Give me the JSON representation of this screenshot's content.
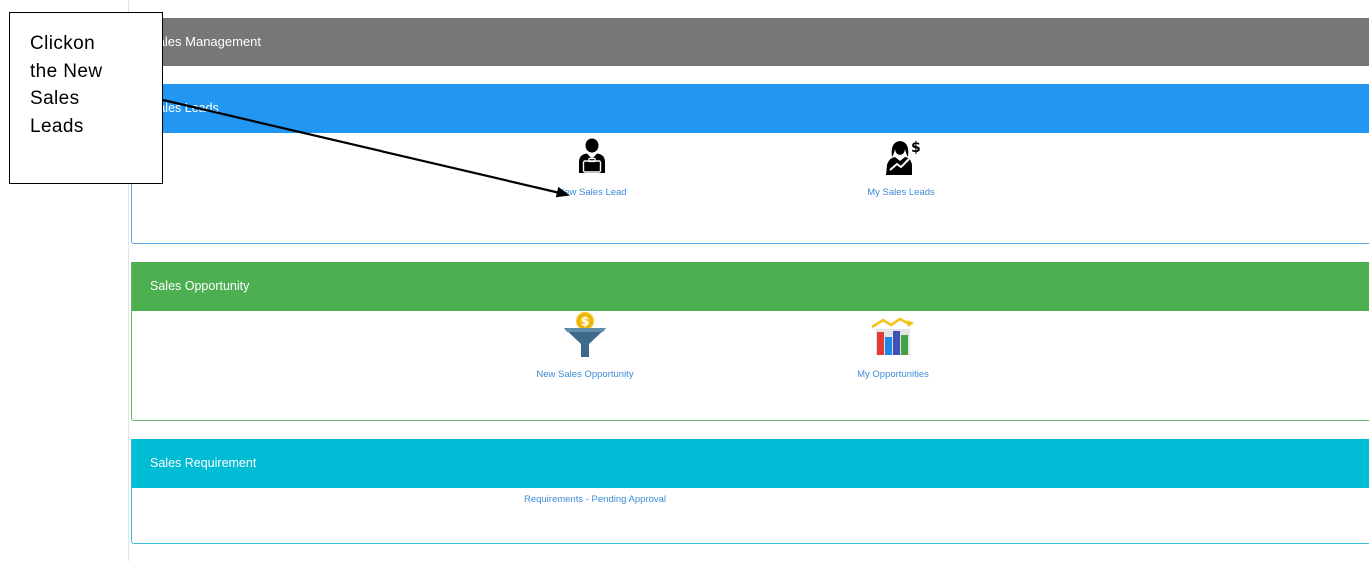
{
  "header": {
    "title": "Sales Management"
  },
  "sections": {
    "leads": {
      "title": "Sales Leads",
      "new_label": "New Sales Lead",
      "mine_label": "My Sales Leads"
    },
    "opportunity": {
      "title": "Sales Opportunity",
      "new_label": "New Sales Opportunity",
      "mine_label": "My Opportunities"
    },
    "requirement": {
      "title": "Sales Requirement",
      "pending_label": "Requirements - Pending Approval"
    }
  },
  "annotation": {
    "text": "Clickon\nthe New\nSales\nLeads"
  },
  "colors": {
    "header": "#777777",
    "leads": "#2196f3",
    "opportunity": "#4caf50",
    "requirement": "#00bcd4",
    "link": "#3c8bd9"
  },
  "icons": {
    "new_lead": "salesman-with-briefcase-icon",
    "my_leads": "woman-with-dollar-chart-icon",
    "new_opportunity": "dollar-funnel-icon",
    "my_opportunities": "bar-chart-trend-icon"
  }
}
